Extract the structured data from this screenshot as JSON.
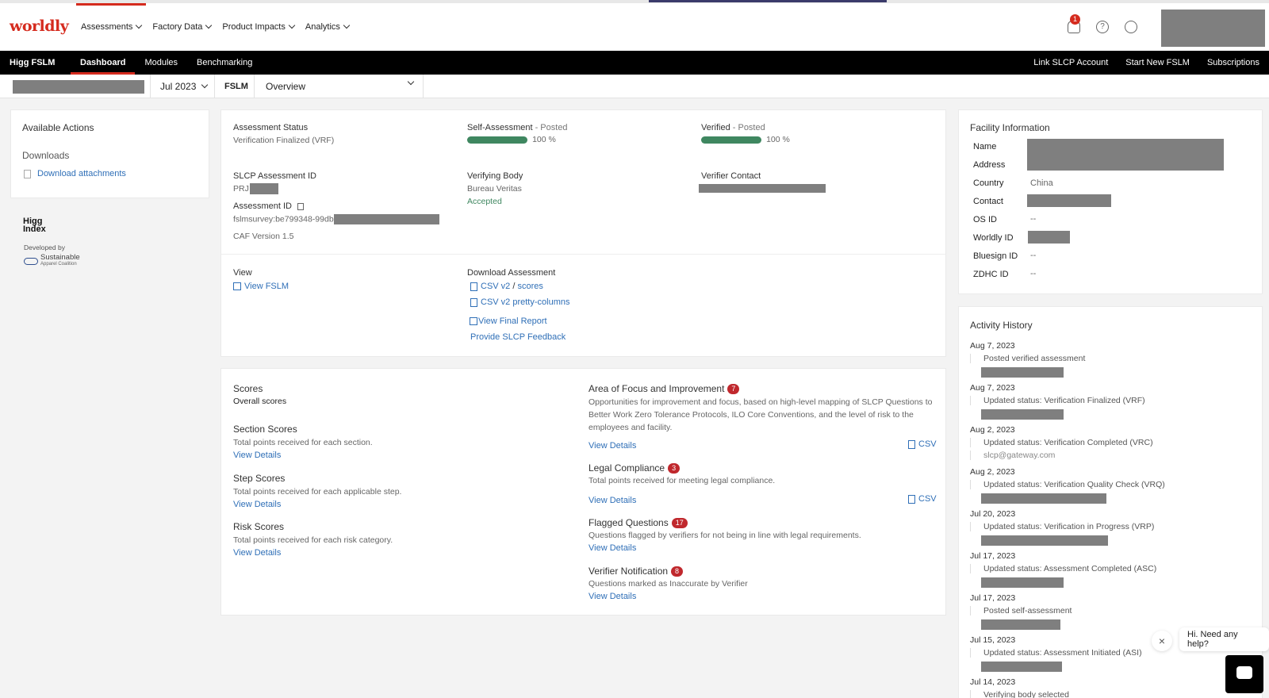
{
  "brand": "worldly",
  "nav": {
    "items": [
      {
        "label": "Assessments"
      },
      {
        "label": "Factory Data"
      },
      {
        "label": "Product Impacts"
      },
      {
        "label": "Analytics"
      }
    ],
    "notification_count": "1"
  },
  "module_bar": {
    "title": "Higg FSLM",
    "tabs": [
      "Dashboard",
      "Modules",
      "Benchmarking"
    ],
    "right_links": [
      "Link SLCP Account",
      "Start New FSLM",
      "Subscriptions"
    ]
  },
  "filter": {
    "period": "Jul 2023",
    "module": "FSLM",
    "view": "Overview"
  },
  "actions": {
    "title": "Available Actions",
    "downloads_heading": "Downloads",
    "download_link": "Download attachments"
  },
  "branding": {
    "higg_logo_top": "Higg",
    "higg_logo_bottom": "Index",
    "developed_by": "Developed by",
    "sac_line1": "Sustainable",
    "sac_line2": "Apparel Coalition"
  },
  "status": {
    "assessment_status_label": "Assessment Status",
    "assessment_status_value": "Verification Finalized (VRF)",
    "self_label": "Self-Assessment",
    "self_state": " - Posted",
    "self_pct": "100 %",
    "self_progress": 100,
    "verified_label": "Verified",
    "verified_state": " - Posted",
    "verified_pct": "100 %",
    "verified_progress": 100,
    "slcp_id_label": "SLCP Assessment ID",
    "slcp_id_prefix": "PRJ",
    "assessment_id_label": "Assessment ID",
    "assessment_id_value": "fslmsurvey:be799348-99db",
    "caf_version": "CAF Version 1.5",
    "verifying_body_label": "Verifying Body",
    "verifying_body_value": "Bureau Veritas",
    "verifying_body_status": "Accepted",
    "verifier_contact_label": "Verifier Contact",
    "view_label": "View",
    "view_link": "View FSLM",
    "download_label": "Download Assessment",
    "csv_v2": "CSV v2",
    "slash": "/",
    "scores_link": "scores",
    "csv_pretty": "CSV v2 pretty-columns",
    "final_report": "View Final Report",
    "feedback": "Provide SLCP Feedback"
  },
  "scores": {
    "title": "Scores",
    "overall": "Overall scores",
    "view_details": "View Details",
    "sections": [
      {
        "title": "Section Scores",
        "desc": "Total points received for each section."
      },
      {
        "title": "Step Scores",
        "desc": "Total points received for each applicable step."
      },
      {
        "title": "Risk Scores",
        "desc": "Total points received for each risk category."
      }
    ],
    "csv": "CSV",
    "focus": {
      "title": "Area of Focus and Improvement",
      "count": "7",
      "desc": "Opportunities for improvement and focus, based on high-level mapping of SLCP Questions to Better Work Zero Tolerance Protocols, ILO Core Conventions, and the level of risk to the employees and facility."
    },
    "legal": {
      "title": "Legal Compliance",
      "count": "3",
      "desc": "Total points received for meeting legal compliance."
    },
    "flagged": {
      "title": "Flagged Questions",
      "count": "17",
      "desc": "Questions flagged by verifiers for not being in line with legal requirements."
    },
    "notification": {
      "title": "Verifier Notification",
      "count": "8",
      "desc": "Questions marked as Inaccurate by Verifier"
    }
  },
  "facility": {
    "title": "Facility Information",
    "rows": [
      {
        "label": "Name",
        "value": ""
      },
      {
        "label": "Address",
        "value": ""
      },
      {
        "label": "Country",
        "value": "China"
      },
      {
        "label": "Contact",
        "value": ""
      },
      {
        "label": "OS ID",
        "value": "--"
      },
      {
        "label": "Worldly ID",
        "value": ""
      },
      {
        "label": "Bluesign ID",
        "value": "--"
      },
      {
        "label": "ZDHC ID",
        "value": "--"
      }
    ]
  },
  "activity": {
    "title": "Activity History",
    "entries": [
      {
        "date": "Aug 7, 2023",
        "text": "Posted verified assessment",
        "extra": ""
      },
      {
        "date": "Aug 7, 2023",
        "text": "Updated status: Verification Finalized (VRF)",
        "extra": ""
      },
      {
        "date": "Aug 2, 2023",
        "text": "Updated status: Verification Completed (VRC)",
        "extra": "slcp@gateway.com"
      },
      {
        "date": "Aug 2, 2023",
        "text": "Updated status: Verification Quality Check (VRQ)",
        "extra": ""
      },
      {
        "date": "Jul 20, 2023",
        "text": "Updated status: Verification in Progress (VRP)",
        "extra": ""
      },
      {
        "date": "Jul 17, 2023",
        "text": "Updated status: Assessment Completed (ASC)",
        "extra": ""
      },
      {
        "date": "Jul 17, 2023",
        "text": "Posted self-assessment",
        "extra": ""
      },
      {
        "date": "Jul 15, 2023",
        "text": "Updated status: Assessment Initiated (ASI)",
        "extra": ""
      },
      {
        "date": "Jul 14, 2023",
        "text": "Verifying body selected",
        "extra": ""
      }
    ]
  },
  "help": {
    "text": "Hi. Need any help?"
  },
  "colors": {
    "brand_red": "#d52b1e",
    "progress_green": "#3f8760",
    "link_blue": "#2f6fb7",
    "count_red": "#c0282d"
  }
}
